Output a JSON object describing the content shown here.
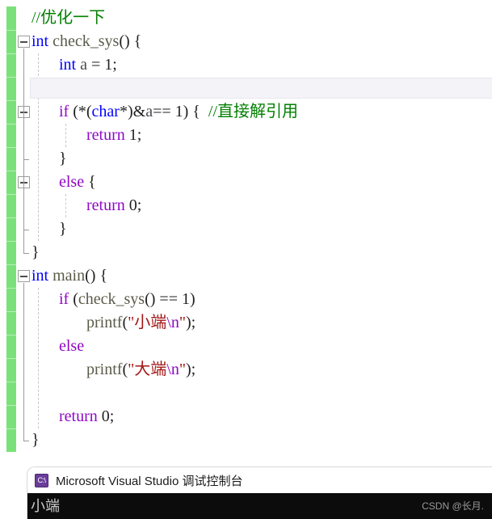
{
  "editor": {
    "change_bar_color": "#7ae17a",
    "current_line_highlight_color": "#f3f3f8",
    "lines": [
      {
        "indent": 0,
        "text": "//优化一下"
      },
      {
        "indent": 0,
        "text": "int check_sys() {"
      },
      {
        "indent": 1,
        "text": "int a = 1;"
      },
      {
        "indent": 1,
        "text": ""
      },
      {
        "indent": 1,
        "text": "if (*(char*)&a== 1) {  //直接解引用"
      },
      {
        "indent": 2,
        "text": "return 1;"
      },
      {
        "indent": 1,
        "text": "}"
      },
      {
        "indent": 1,
        "text": "else {"
      },
      {
        "indent": 2,
        "text": "return 0;"
      },
      {
        "indent": 1,
        "text": "}"
      },
      {
        "indent": 0,
        "text": "}"
      },
      {
        "indent": 0,
        "text": "int main() {"
      },
      {
        "indent": 1,
        "text": "if (check_sys() == 1)"
      },
      {
        "indent": 2,
        "text": "printf(\"小端\\n\");"
      },
      {
        "indent": 1,
        "text": "else"
      },
      {
        "indent": 2,
        "text": "printf(\"大端\\n\");"
      },
      {
        "indent": 1,
        "text": ""
      },
      {
        "indent": 1,
        "text": "return 0;"
      },
      {
        "indent": 0,
        "text": "}"
      }
    ],
    "tokens": [
      [
        {
          "t": "//优化一下",
          "c": "tok-cmt"
        }
      ],
      [
        {
          "t": "int",
          "c": "tok-type"
        },
        {
          "t": " ",
          "c": "tok-punct"
        },
        {
          "t": "check_sys",
          "c": "tok-fn"
        },
        {
          "t": "() {",
          "c": "tok-punct"
        }
      ],
      [
        {
          "t": "int",
          "c": "tok-type"
        },
        {
          "t": " ",
          "c": "tok-punct"
        },
        {
          "t": "a",
          "c": "tok-id"
        },
        {
          "t": " = ",
          "c": "tok-punct"
        },
        {
          "t": "1",
          "c": "tok-num"
        },
        {
          "t": ";",
          "c": "tok-punct"
        }
      ],
      [],
      [
        {
          "t": "if",
          "c": "tok-kw"
        },
        {
          "t": " (*(",
          "c": "tok-punct"
        },
        {
          "t": "char",
          "c": "tok-type"
        },
        {
          "t": "*)&",
          "c": "tok-punct"
        },
        {
          "t": "a",
          "c": "tok-id"
        },
        {
          "t": "== ",
          "c": "tok-punct"
        },
        {
          "t": "1",
          "c": "tok-num"
        },
        {
          "t": ") {  ",
          "c": "tok-punct"
        },
        {
          "t": "//直接解引用",
          "c": "tok-cmt"
        }
      ],
      [
        {
          "t": "return",
          "c": "tok-kw"
        },
        {
          "t": " ",
          "c": "tok-punct"
        },
        {
          "t": "1",
          "c": "tok-num"
        },
        {
          "t": ";",
          "c": "tok-punct"
        }
      ],
      [
        {
          "t": "}",
          "c": "tok-brace"
        }
      ],
      [
        {
          "t": "else",
          "c": "tok-kw"
        },
        {
          "t": " {",
          "c": "tok-punct"
        }
      ],
      [
        {
          "t": "return",
          "c": "tok-kw"
        },
        {
          "t": " ",
          "c": "tok-punct"
        },
        {
          "t": "0",
          "c": "tok-num"
        },
        {
          "t": ";",
          "c": "tok-punct"
        }
      ],
      [
        {
          "t": "}",
          "c": "tok-brace"
        }
      ],
      [
        {
          "t": "}",
          "c": "tok-brace"
        }
      ],
      [
        {
          "t": "int",
          "c": "tok-type"
        },
        {
          "t": " ",
          "c": "tok-punct"
        },
        {
          "t": "main",
          "c": "tok-fn"
        },
        {
          "t": "() {",
          "c": "tok-punct"
        }
      ],
      [
        {
          "t": "if",
          "c": "tok-kw"
        },
        {
          "t": " (",
          "c": "tok-punct"
        },
        {
          "t": "check_sys",
          "c": "tok-fn"
        },
        {
          "t": "() == ",
          "c": "tok-punct"
        },
        {
          "t": "1",
          "c": "tok-num"
        },
        {
          "t": ")",
          "c": "tok-punct"
        }
      ],
      [
        {
          "t": "printf",
          "c": "tok-fn"
        },
        {
          "t": "(",
          "c": "tok-punct"
        },
        {
          "t": "\"小端",
          "c": "tok-str"
        },
        {
          "t": "\\n",
          "c": "tok-kw"
        },
        {
          "t": "\"",
          "c": "tok-str"
        },
        {
          "t": ");",
          "c": "tok-punct"
        }
      ],
      [
        {
          "t": "else",
          "c": "tok-kw"
        }
      ],
      [
        {
          "t": "printf",
          "c": "tok-fn"
        },
        {
          "t": "(",
          "c": "tok-punct"
        },
        {
          "t": "\"大端",
          "c": "tok-str"
        },
        {
          "t": "\\n",
          "c": "tok-kw"
        },
        {
          "t": "\"",
          "c": "tok-str"
        },
        {
          "t": ");",
          "c": "tok-punct"
        }
      ],
      [],
      [
        {
          "t": "return",
          "c": "tok-kw"
        },
        {
          "t": " ",
          "c": "tok-punct"
        },
        {
          "t": "0",
          "c": "tok-num"
        },
        {
          "t": ";",
          "c": "tok-punct"
        }
      ],
      [
        {
          "t": "}",
          "c": "tok-brace"
        }
      ]
    ],
    "collapse_buttons": [
      1,
      4,
      7,
      11
    ],
    "current_line_index": 3
  },
  "console": {
    "icon_label": "C:\\",
    "title": "Microsoft Visual Studio 调试控制台",
    "output": "小端",
    "watermark": "CSDN @长月."
  }
}
